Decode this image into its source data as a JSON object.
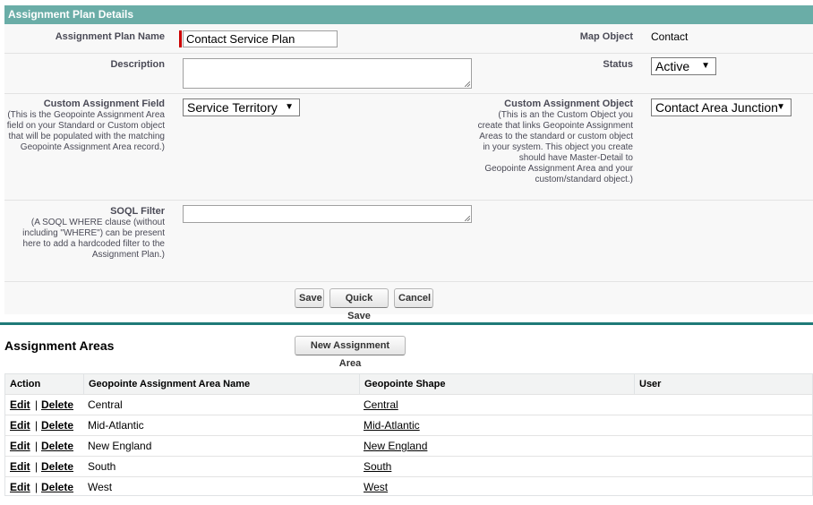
{
  "detail": {
    "header": "Assignment Plan Details",
    "plan_name": {
      "label": "Assignment Plan Name",
      "value": "Contact Service Plan"
    },
    "map_object": {
      "label": "Map Object",
      "value": "Contact"
    },
    "description": {
      "label": "Description",
      "value": ""
    },
    "status": {
      "label": "Status",
      "value": "Active"
    },
    "custom_field": {
      "label": "Custom Assignment Field",
      "help": "(This is the Geopointe Assignment Area field on your Standard or Custom object that will be populated with the matching Geopointe Assignment Area record.)",
      "value": "Service Territory"
    },
    "custom_object": {
      "label": "Custom Assignment Object",
      "help": "(This is an the Custom Object you create that links Geopointe Assignment Areas to the standard or custom object in your system. This object you create should have Master-Detail to Geopointe Assignment Area and your custom/standard object.)",
      "value": "Contact Area Junction"
    },
    "soql_filter": {
      "label": "SOQL Filter",
      "help": "(A SOQL WHERE clause (without including \"WHERE\") can be present here to add a hardcoded filter to the Assignment Plan.)",
      "value": ""
    },
    "buttons": {
      "save": "Save",
      "quick_save": "Quick Save",
      "cancel": "Cancel"
    }
  },
  "related": {
    "title": "Assignment Areas",
    "new_button": "New Assignment Area",
    "columns": {
      "action": "Action",
      "name": "Geopointe Assignment Area Name",
      "shape": "Geopointe Shape",
      "user": "User"
    },
    "action_edit": "Edit",
    "action_separator": "|",
    "action_delete": "Delete",
    "rows": [
      {
        "name": "Central",
        "shape": "Central",
        "user": ""
      },
      {
        "name": "Mid-Atlantic",
        "shape": "Mid-Atlantic",
        "user": ""
      },
      {
        "name": "New England",
        "shape": "New England",
        "user": ""
      },
      {
        "name": "South",
        "shape": "South",
        "user": ""
      },
      {
        "name": "West",
        "shape": "West",
        "user": ""
      }
    ]
  }
}
